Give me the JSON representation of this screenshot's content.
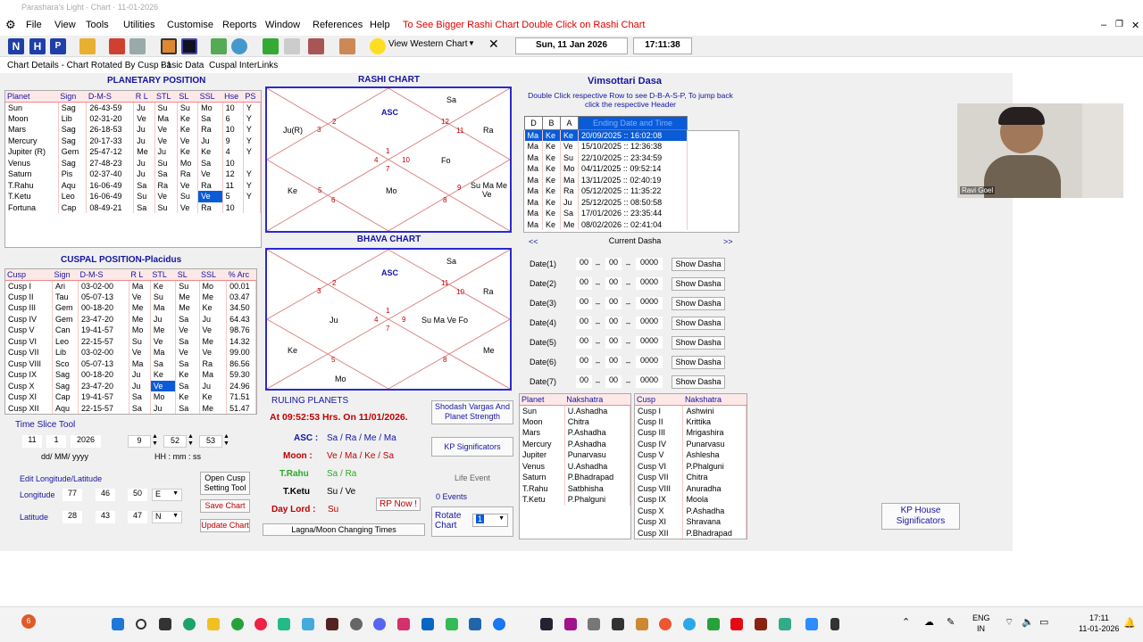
{
  "window": {
    "title": "Parashara's Light · Chart · 11-01-2026"
  },
  "menu": {
    "items": [
      "File",
      "View",
      "Tools",
      "Utilities",
      "Customise",
      "Reports",
      "Window",
      "References",
      "Help"
    ],
    "hint": "To See Bigger Rashi Chart Double Click on Rashi Chart"
  },
  "toolbar": {
    "view_western": "View Western Chart",
    "date": "Sun, 11 Jan 2026",
    "time": "17:11:38"
  },
  "tabs": [
    "Chart Details - Chart Rotated By Cusp - 1",
    "Basic Data",
    "Cuspal InterLinks"
  ],
  "planetary": {
    "title": "PLANETARY POSITION",
    "headers": [
      "Planet",
      "Sign",
      "D-M-S",
      "R L",
      "STL",
      "SL",
      "SSL",
      "Hse",
      "PS"
    ],
    "rows": [
      [
        "Sun",
        "Sag",
        "26-43-59",
        "Ju",
        "Su",
        "Su",
        "Mo",
        "10",
        "Y"
      ],
      [
        "Moon",
        "Lib",
        "02-31-20",
        "Ve",
        "Ma",
        "Ke",
        "Sa",
        "6",
        "Y"
      ],
      [
        "Mars",
        "Sag",
        "26-18-53",
        "Ju",
        "Ve",
        "Ke",
        "Ra",
        "10",
        "Y"
      ],
      [
        "Mercury",
        "Sag",
        "20-17-33",
        "Ju",
        "Ve",
        "Ve",
        "Ju",
        "9",
        "Y"
      ],
      [
        "Jupiter (R)",
        "Gem",
        "25-47-12",
        "Me",
        "Ju",
        "Ke",
        "Ke",
        "4",
        "Y"
      ],
      [
        "Venus",
        "Sag",
        "27-48-23",
        "Ju",
        "Su",
        "Mo",
        "Sa",
        "10",
        ""
      ],
      [
        "Saturn",
        "Pis",
        "02-37-40",
        "Ju",
        "Sa",
        "Ra",
        "Ve",
        "12",
        "Y"
      ],
      [
        "T.Rahu",
        "Aqu",
        "16-06-49",
        "Sa",
        "Ra",
        "Ve",
        "Ra",
        "11",
        "Y"
      ],
      [
        "T.Ketu",
        "Leo",
        "16-06-49",
        "Su",
        "Ve",
        "Su",
        "Ve",
        "5",
        "Y"
      ],
      [
        "Fortuna",
        "Cap",
        "08-49-21",
        "Sa",
        "Su",
        "Ve",
        "Ra",
        "10",
        ""
      ]
    ]
  },
  "cuspal": {
    "title": "CUSPAL POSITION-Placidus",
    "headers": [
      "Cusp",
      "Sign",
      "D-M-S",
      "R L",
      "STL",
      "SL",
      "SSL",
      "% Arc"
    ],
    "rows": [
      [
        "Cusp I",
        "Ari",
        "03-02-00",
        "Ma",
        "Ke",
        "Su",
        "Mo",
        "00.01"
      ],
      [
        "Cusp II",
        "Tau",
        "05-07-13",
        "Ve",
        "Su",
        "Me",
        "Me",
        "03.47"
      ],
      [
        "Cusp III",
        "Gem",
        "00-18-20",
        "Me",
        "Ma",
        "Me",
        "Ke",
        "34.50"
      ],
      [
        "Cusp IV",
        "Gem",
        "23-47-20",
        "Me",
        "Ju",
        "Sa",
        "Ju",
        "64.43"
      ],
      [
        "Cusp V",
        "Can",
        "19-41-57",
        "Mo",
        "Me",
        "Ve",
        "Ve",
        "98.76"
      ],
      [
        "Cusp VI",
        "Leo",
        "22-15-57",
        "Su",
        "Ve",
        "Sa",
        "Me",
        "14.32"
      ],
      [
        "Cusp VII",
        "Lib",
        "03-02-00",
        "Ve",
        "Ma",
        "Ve",
        "Ve",
        "99.00"
      ],
      [
        "Cusp VIII",
        "Sco",
        "05-07-13",
        "Ma",
        "Sa",
        "Sa",
        "Ra",
        "86.56"
      ],
      [
        "Cusp IX",
        "Sag",
        "00-18-20",
        "Ju",
        "Ke",
        "Ke",
        "Ma",
        "59.30"
      ],
      [
        "Cusp X",
        "Sag",
        "23-47-20",
        "Ju",
        "Ve",
        "Sa",
        "Ju",
        "24.96"
      ],
      [
        "Cusp XI",
        "Cap",
        "19-41-57",
        "Sa",
        "Mo",
        "Ke",
        "Ke",
        "71.51"
      ],
      [
        "Cusp XII",
        "Aqu",
        "22-15-57",
        "Sa",
        "Ju",
        "Sa",
        "Me",
        "51.47"
      ]
    ]
  },
  "rashi": {
    "title": "RASHI CHART",
    "asc": "ASC",
    "nums": [
      "2",
      "3",
      "12",
      "11",
      "4",
      "1",
      "7",
      "10",
      "5",
      "6",
      "9",
      "8"
    ],
    "planets": [
      "Sa",
      "Ju(R)",
      "Ra",
      "Fo",
      "Ke",
      "Mo",
      "Su Ma Me",
      "Ve"
    ]
  },
  "bhava": {
    "title": "BHAVA CHART",
    "asc": "ASC",
    "nums": [
      "2",
      "3",
      "11",
      "10",
      "1",
      "4",
      "9",
      "7",
      "5",
      "8"
    ],
    "planets": [
      "Sa",
      "Ra",
      "Ju",
      "Su Ma Ve Fo",
      "Ke",
      "Me",
      "Mo"
    ]
  },
  "dasa": {
    "title": "Vimsottari Dasa",
    "note": "Double Click respective Row to see D-B-A-S-P, To jump back click the respective Header",
    "headers": [
      "D",
      "B",
      "A",
      "Ending Date and Time"
    ],
    "rows": [
      [
        "Ma",
        "Ke",
        "Ke",
        "20/09/2025 :: 16:02:08"
      ],
      [
        "Ma",
        "Ke",
        "Ve",
        "15/10/2025 :: 12:36:38"
      ],
      [
        "Ma",
        "Ke",
        "Su",
        "22/10/2025 :: 23:34:59"
      ],
      [
        "Ma",
        "Ke",
        "Mo",
        "04/11/2025 :: 09:52:14"
      ],
      [
        "Ma",
        "Ke",
        "Ma",
        "13/11/2025 :: 02:40:19"
      ],
      [
        "Ma",
        "Ke",
        "Ra",
        "05/12/2025 :: 11:35:22"
      ],
      [
        "Ma",
        "Ke",
        "Ju",
        "25/12/2025 :: 08:50:58"
      ],
      [
        "Ma",
        "Ke",
        "Sa",
        "17/01/2026 :: 23:35:44"
      ],
      [
        "Ma",
        "Ke",
        "Me",
        "08/02/2026 :: 02:41:04"
      ]
    ],
    "prev": "<<",
    "current": "Current Dasha",
    "next": ">>"
  },
  "dates": {
    "labels": [
      "Date(1)",
      "Date(2)",
      "Date(3)",
      "Date(4)",
      "Date(5)",
      "Date(6)",
      "Date(7)"
    ],
    "dd": "00",
    "mm": "00",
    "yyyy": "0000",
    "button": "Show Dasha"
  },
  "naks_p": {
    "headers": [
      "Planet",
      "Nakshatra"
    ],
    "rows": [
      [
        "Sun",
        "U.Ashadha"
      ],
      [
        "Moon",
        "Chitra"
      ],
      [
        "Mars",
        "P.Ashadha"
      ],
      [
        "Mercury",
        "P.Ashadha"
      ],
      [
        "Jupiter",
        "Punarvasu"
      ],
      [
        "Venus",
        "U.Ashadha"
      ],
      [
        "Saturn",
        "P.Bhadrapad"
      ],
      [
        "T.Rahu",
        "Satbhisha"
      ],
      [
        "T.Ketu",
        "P.Phalguni"
      ]
    ]
  },
  "naks_c": {
    "headers": [
      "Cusp",
      "Nakshatra"
    ],
    "rows": [
      [
        "Cusp I",
        "Ashwini"
      ],
      [
        "Cusp II",
        "Krittika"
      ],
      [
        "Cusp III",
        "Mrigashira"
      ],
      [
        "Cusp IV",
        "Punarvasu"
      ],
      [
        "Cusp V",
        "Ashlesha"
      ],
      [
        "Cusp VI",
        "P.Phalguni"
      ],
      [
        "Cusp VII",
        "Chitra"
      ],
      [
        "Cusp VIII",
        "Anuradha"
      ],
      [
        "Cusp IX",
        "Moola"
      ],
      [
        "Cusp X",
        "P.Ashadha"
      ],
      [
        "Cusp XI",
        "Shravana"
      ],
      [
        "Cusp XII",
        "P.Bhadrapad"
      ]
    ]
  },
  "ruling": {
    "title": "RULING PLANETS",
    "at": "At 09:52:53 Hrs. On 11/01/2026.",
    "asc_l": "ASC :",
    "asc_v": "Sa / Ra / Me / Ma",
    "moon_l": "Moon :",
    "moon_v": "Ve / Ma / Ke / Sa",
    "rahu_l": "T.Rahu",
    "rahu_v": "Sa / Ra",
    "ketu_l": "T.Ketu",
    "ketu_v": "Su / Ve",
    "day_l": "Day Lord :",
    "day_v": "Su",
    "rp": "RP Now !"
  },
  "side": {
    "shodash": "Shodash Vargas And Planet Strength",
    "kp": "KP Significators",
    "life": "Life Event",
    "events": "0 Events",
    "rotate": "Rotate Chart",
    "rotate_val": "1",
    "lagna": "Lagna/Moon Changing Times",
    "kp_house": "KP House Significators"
  },
  "timeslice": {
    "title": "Time Slice Tool",
    "d": "11",
    "m": "1",
    "y": "2026",
    "hh": "9",
    "mm": "52",
    "ss": "53",
    "fmt1": "dd/ MM/ yyyy",
    "fmt2": "HH : mm : ss"
  },
  "geo": {
    "title": "Edit Longitude/Latitude",
    "lon_l": "Longitude",
    "lon": [
      "77",
      "46",
      "50",
      "E"
    ],
    "lat_l": "Latitude",
    "lat": [
      "28",
      "43",
      "47",
      "N"
    ],
    "cusp_btn": "Open Cusp Setting Tool",
    "save": "Save Chart",
    "update": "Update Chart"
  },
  "video": {
    "name": "Ravi Goel"
  },
  "taskbar": {
    "lang1": "ENG",
    "lang2": "IN",
    "time": "17:11",
    "date": "11-01-2026",
    "notif": "6"
  }
}
